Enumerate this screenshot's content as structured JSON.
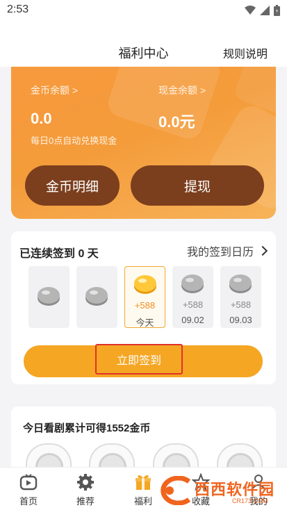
{
  "status_bar": {
    "time": "2:53"
  },
  "header": {
    "title": "福利中心",
    "rules_label": "规则说明"
  },
  "balance": {
    "coin_label": "金币余额 >",
    "coin_value": "0.0",
    "cash_label": "现金余额 >",
    "cash_value": "0.0元",
    "note": "每日0点自动兑换现金",
    "detail_button": "金币明细",
    "withdraw_button": "提现"
  },
  "signin": {
    "streak_text": "已连续签到 0 天",
    "calendar_label": "我的签到日历",
    "days": [
      {
        "amount": "",
        "date": "",
        "state": "past"
      },
      {
        "amount": "",
        "date": "",
        "state": "past"
      },
      {
        "amount": "+588",
        "date": "今天",
        "state": "today"
      },
      {
        "amount": "+588",
        "date": "09.02",
        "state": "future"
      },
      {
        "amount": "+588",
        "date": "09.03",
        "state": "future"
      }
    ],
    "sign_button": "立即签到"
  },
  "watch": {
    "title": "今日看剧累计可得1552金币"
  },
  "tabbar": {
    "items": [
      {
        "label": "首页",
        "icon": "play-tv-icon"
      },
      {
        "label": "推荐",
        "icon": "gear-icon"
      },
      {
        "label": "福利",
        "icon": "gift-icon"
      },
      {
        "label": "收藏",
        "icon": "star-icon"
      },
      {
        "label": "我的",
        "icon": "person-icon"
      }
    ]
  },
  "watermark": {
    "text": "西西软件园",
    "sub": "CR173.COM"
  },
  "colors": {
    "accent_orange": "#f5a623",
    "card_gradient_start": "#f79a3e",
    "brown_button": "#7b3f1e",
    "highlight_red": "#e0312a"
  }
}
